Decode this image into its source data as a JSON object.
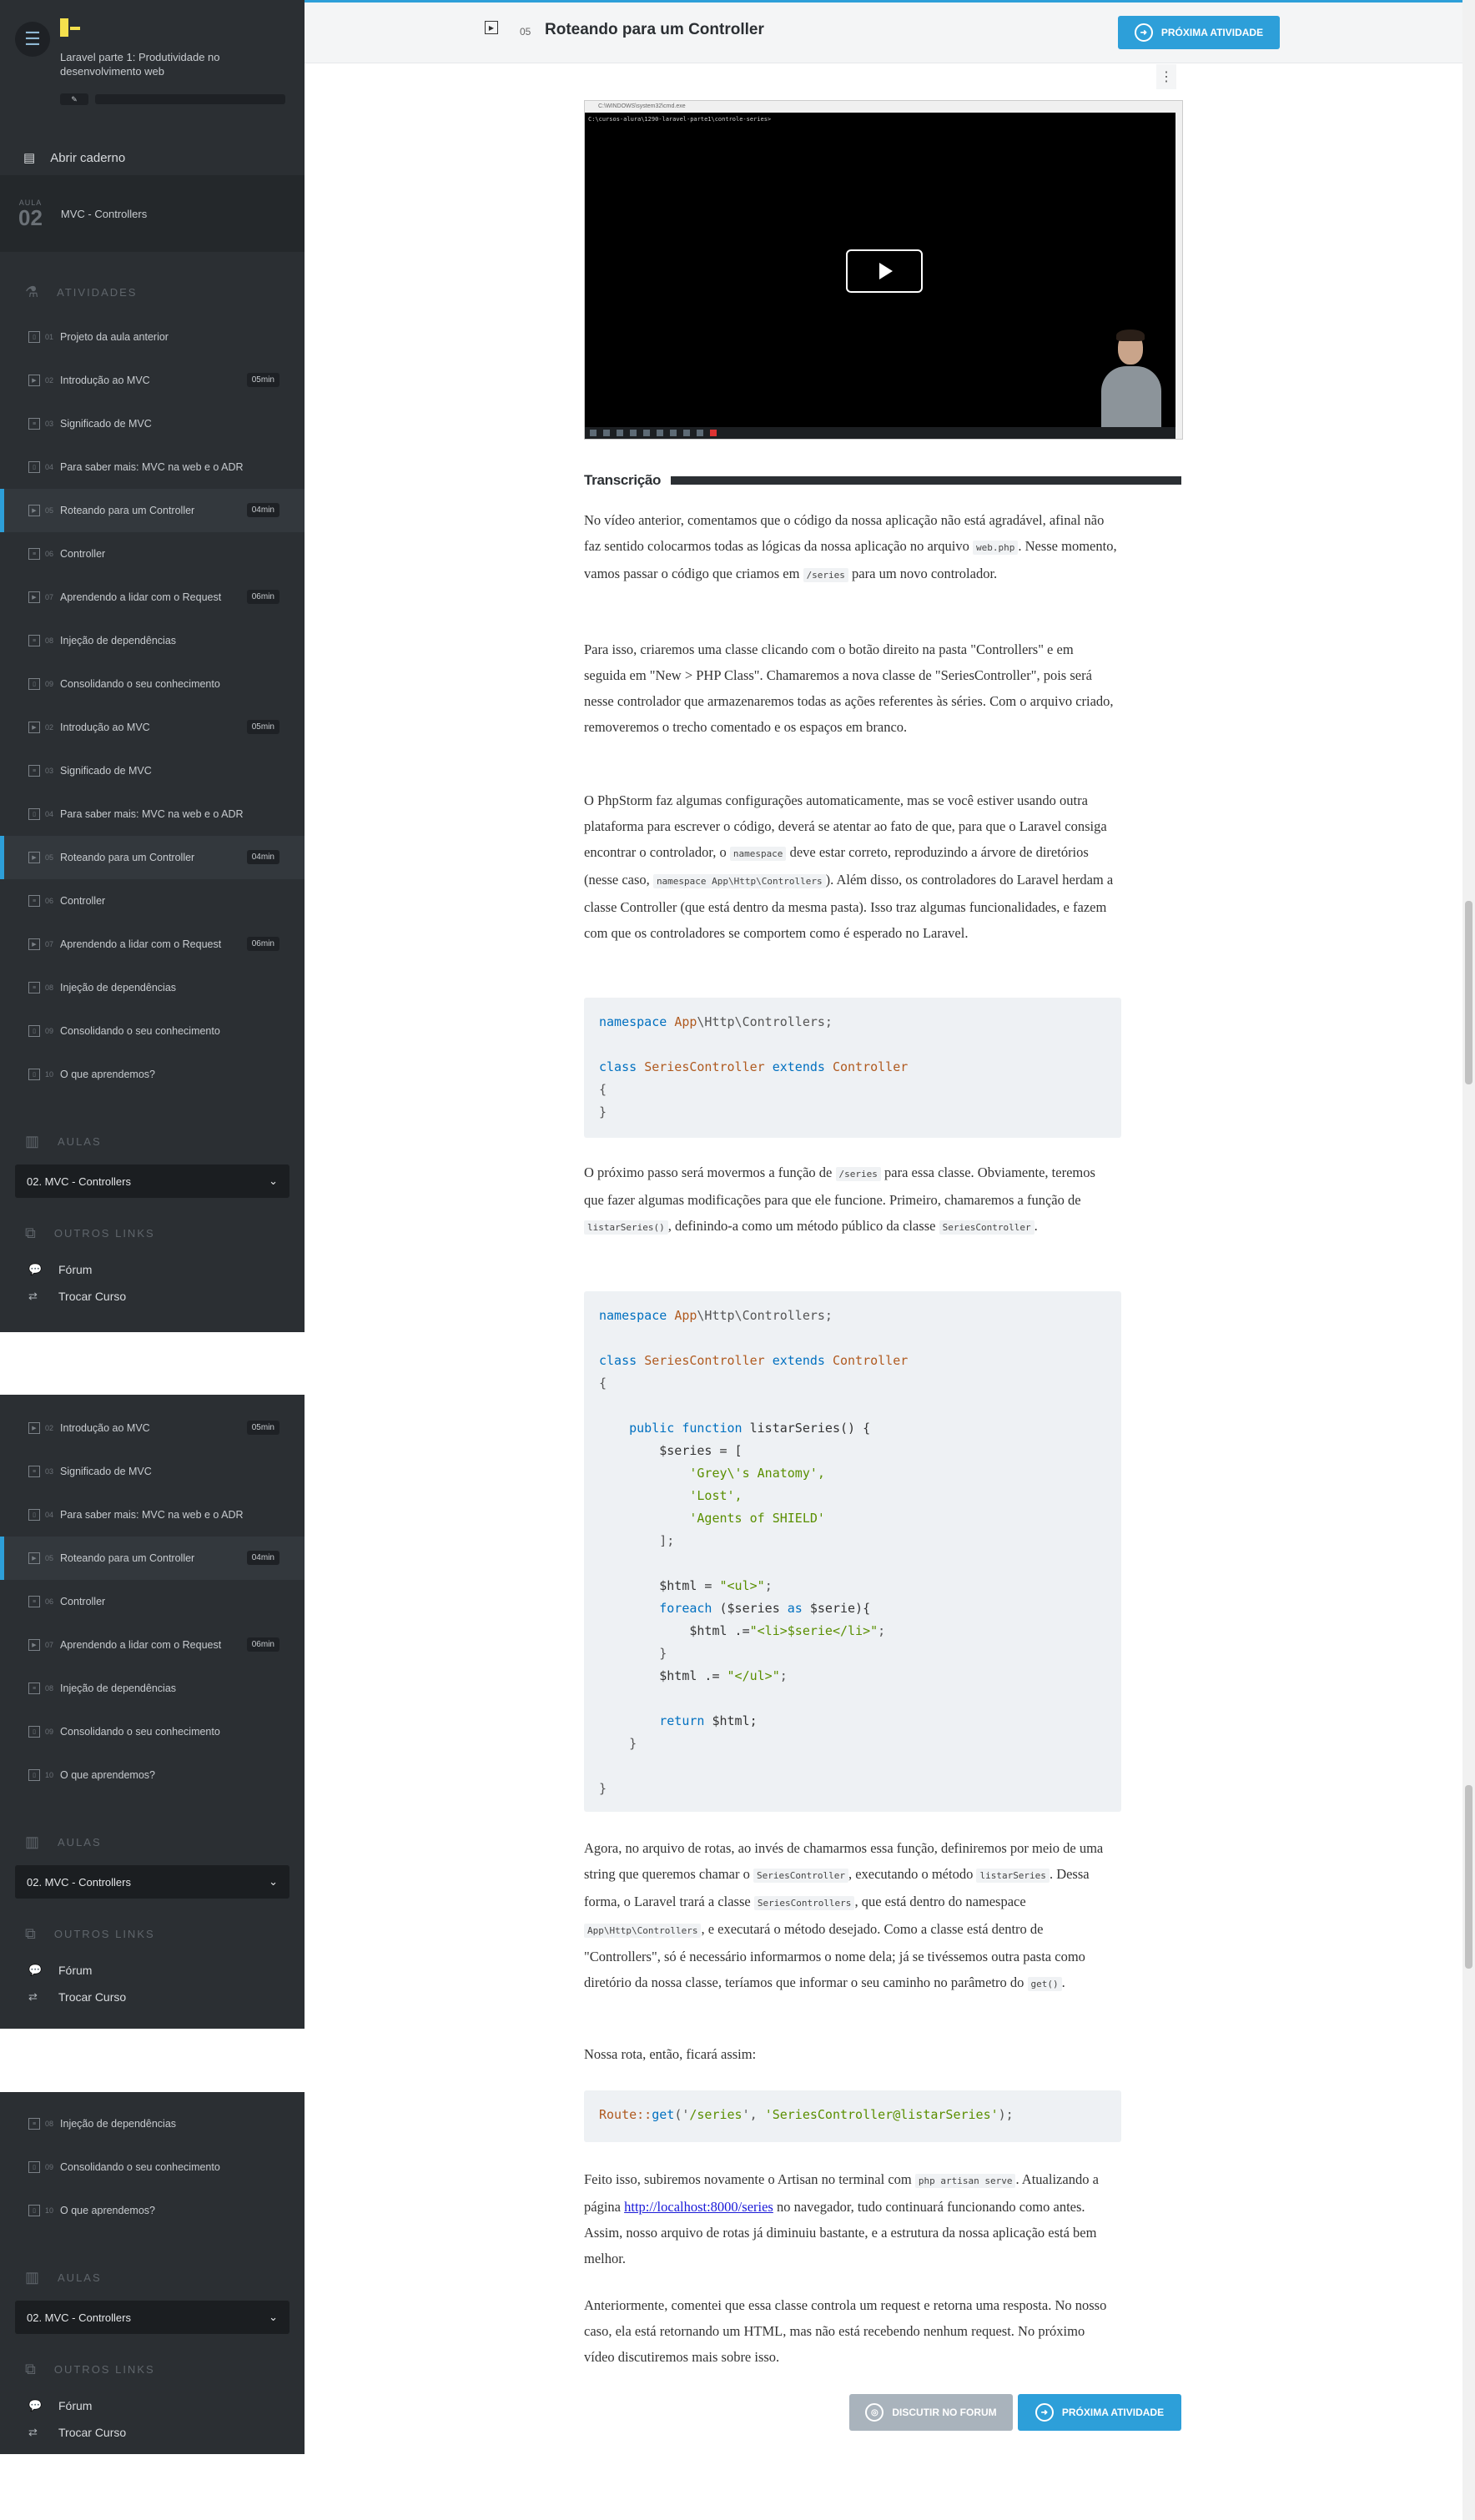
{
  "course": {
    "title": "Laravel parte 1: Produtividade no desenvolvimento web",
    "progress_percent": 0
  },
  "sidebar": {
    "open_notebook": "Abrir caderno",
    "lesson": {
      "label": "AULA",
      "number": "02",
      "name": "MVC - Controllers"
    },
    "activities_title": "ATIVIDADES",
    "activities": [
      {
        "num": "01",
        "label": "Projeto da aula anterior",
        "duration": "",
        "icon": "book-icon"
      },
      {
        "num": "02",
        "label": "Introdução ao MVC",
        "duration": "05min",
        "icon": "video-icon"
      },
      {
        "num": "03",
        "label": "Significado de MVC",
        "duration": "",
        "icon": "list-icon"
      },
      {
        "num": "04",
        "label": "Para saber mais: MVC na web e o ADR",
        "duration": "",
        "icon": "book-icon"
      },
      {
        "num": "05",
        "label": "Roteando para um Controller",
        "duration": "04min",
        "icon": "video-icon"
      },
      {
        "num": "06",
        "label": "Controller",
        "duration": "",
        "icon": "list-icon"
      },
      {
        "num": "07",
        "label": "Aprendendo a lidar com o Request",
        "duration": "06min",
        "icon": "video-icon"
      },
      {
        "num": "08",
        "label": "Injeção de dependências",
        "duration": "",
        "icon": "list-icon"
      },
      {
        "num": "09",
        "label": "Consolidando o seu conhecimento",
        "duration": "",
        "icon": "book-icon"
      },
      {
        "num": "10",
        "label": "O que aprendemos?",
        "duration": "",
        "icon": "book-icon"
      }
    ],
    "aulas_title": "AULAS",
    "aulas_selected": "02. MVC - Controllers",
    "links_title": "OUTROS LINKS",
    "links": [
      {
        "label": "Fórum",
        "icon": "chat-icon"
      },
      {
        "label": "Trocar Curso",
        "icon": "swap-icon"
      }
    ]
  },
  "header": {
    "activity_number": "05",
    "activity_title": "Roteando para um Controller",
    "next_label": "PRÓXIMA ATIVIDADE"
  },
  "video": {
    "window_title": "C:\\WINDOWS\\system32\\cmd.exe",
    "cmd_line": "C:\\cursos-alura\\1290-laravel-parte1\\controle-series>"
  },
  "transcription": {
    "title": "Transcrição",
    "p1": [
      "No vídeo anterior, comentamos que o código da nossa aplicação não está agradável, afinal não faz sentido colocarmos todas as lógicas da nossa aplicação no arquivo ",
      "web.php",
      ". Nesse momento, vamos passar o código que criamos em ",
      "/series",
      " para um novo controlador."
    ],
    "p2": "Para isso, criaremos uma classe clicando com o botão direito na pasta \"Controllers\" e em seguida em \"New > PHP Class\". Chamaremos a nova classe de \"SeriesController\", pois será nesse controlador que armazenaremos todas as ações referentes às séries. Com o arquivo criado, removeremos o trecho comentado e os espaços em branco.",
    "p3": [
      "O PhpStorm faz algumas configurações automaticamente, mas se você estiver usando outra plataforma para escrever o código, deverá se atentar ao fato de que, para que o Laravel consiga encontrar o controlador, o ",
      "namespace",
      " deve estar correto, reproduzindo a árvore de diretórios (nesse caso, ",
      "namespace App\\Http\\Controllers",
      "). Além disso, os controladores do Laravel herdam a classe Controller (que está dentro da mesma pasta). Isso traz algumas funcionalidades, e fazem com que os controladores se comportem como é esperado no Laravel."
    ],
    "p4": [
      "O próximo passo será movermos a função de ",
      "/series",
      " para essa classe. Obviamente, teremos que fazer algumas modificações para que ele funcione. Primeiro, chamaremos a função de ",
      "listarSeries()",
      ", definindo-a como um método público da classe ",
      "SeriesController",
      "."
    ],
    "p5": [
      "Agora, no arquivo de rotas, ao invés de chamarmos essa função, definiremos por meio de uma string que queremos chamar o ",
      "SeriesController",
      ", executando o método ",
      "listarSeries",
      ". Dessa forma, o Laravel trará a classe ",
      "SeriesControllers",
      ", que está dentro do namespace ",
      "App\\Http\\Controllers",
      ", e executará o método desejado. Como a classe está dentro de \"Controllers\", só é necessário informarmos o nome dela; já se tivéssemos outra pasta como diretório da nossa classe, teríamos que informar o seu caminho no parâmetro do ",
      "get()",
      "."
    ],
    "p6": "Nossa rota, então, ficará assim:",
    "p7": [
      "Feito isso, subiremos novamente o Artisan no terminal com ",
      "php artisan serve",
      ". Atualizando a página ",
      "http://localhost:8000/series",
      " no navegador, tudo continuará funcionando como antes. Assim, nosso arquivo de rotas já diminuiu bastante, e a estrutura da nossa aplicação está bem melhor."
    ],
    "p8": "Anteriormente, comentei que essa classe controla um request e retorna uma resposta. No nosso caso, ela está retornando um HTML, mas não está recebendo nenhum request. No próximo vídeo discutiremos mais sobre isso."
  },
  "code": {
    "c1": {
      "ns_kw": "namespace",
      "ns_root": "App",
      "ns_rest": "\\Http\\Controllers;",
      "class_kw": "class",
      "class_name": "SeriesController",
      "extends_kw": "extends",
      "parent": "Controller",
      "open": "{",
      "close": "}"
    },
    "c2": {
      "public_kw": "public",
      "function_kw": "function",
      "method": "listarSeries() {",
      "series_var": "$series = [",
      "items": [
        "'Grey\\'s Anatomy',",
        "'Lost',",
        "'Agents of SHIELD'"
      ],
      "arr_close": "];",
      "html_init_a": "$html = ",
      "html_init_b": "\"<ul>\"",
      "html_init_c": ";",
      "foreach_kw": "foreach",
      "foreach_a": " ($series ",
      "as_kw": "as",
      "foreach_b": " $serie){",
      "append1_a": "$html .=",
      "append1_b": "\"<li>$serie</li>\"",
      "append1_c": ";",
      "inner_close": "}",
      "append2_a": "$html .= ",
      "append2_b": "\"</ul>\"",
      "append2_c": ";",
      "return_kw": "return",
      "return_rest": " $html;",
      "method_close": "}",
      "class_close": "}"
    },
    "c3": {
      "route": "Route::",
      "get": "get",
      "args_a": "('",
      "path": "/series",
      "args_b": "', ",
      "action": "'SeriesController@listarSeries'",
      "args_c": ");"
    }
  },
  "footer": {
    "forum_label": "DISCUTIR NO FORUM",
    "next_label": "PRÓXIMA ATIVIDADE"
  }
}
